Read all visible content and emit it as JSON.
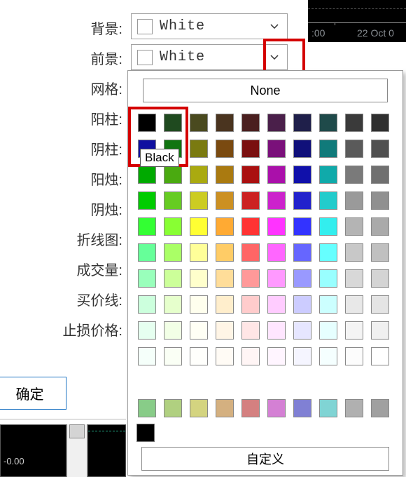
{
  "settings_labels": [
    "背景:",
    "前景:",
    "网格:",
    "阳柱:",
    "阴柱:",
    "阳烛:",
    "阴烛:",
    "折线图:",
    "成交量:",
    "买价线:",
    "止损价格:"
  ],
  "selector1": {
    "color": "#ffffff",
    "label": "White"
  },
  "selector2": {
    "color": "#ffffff",
    "label": "White"
  },
  "ok_button": "确定",
  "none_button": "None",
  "custom_button": "自定义",
  "tooltip": "Black",
  "chart_time_prefix": ":00",
  "chart_date": "22 Oct 0",
  "mini_val": "-0.00",
  "color_grid": [
    [
      "#000000",
      "#1f4a1f",
      "#4a4a1f",
      "#4a341f",
      "#4a1f1f",
      "#4a1f4a",
      "#1f1f4a",
      "#1f4a4a",
      "#3a3a3a",
      "#2f2f2f"
    ],
    [
      "#0f0fa0",
      "#107510",
      "#7a7a10",
      "#7a4a10",
      "#7a1010",
      "#7a107a",
      "#10107a",
      "#107a7a",
      "#5a5a5a",
      "#505050"
    ],
    [
      "#00aa00",
      "#4aaa10",
      "#aaaa10",
      "#aa7a10",
      "#aa1010",
      "#aa10aa",
      "#1010aa",
      "#10aaaa",
      "#7a7a7a",
      "#707070"
    ],
    [
      "#00cc00",
      "#66cc22",
      "#cccc22",
      "#cc9022",
      "#cc2222",
      "#cc22cc",
      "#2222cc",
      "#22cccc",
      "#9a9a9a",
      "#909090"
    ],
    [
      "#33ff33",
      "#88ff33",
      "#ffff33",
      "#ffaa33",
      "#ff3333",
      "#ff33ff",
      "#3333ff",
      "#33eeee",
      "#b4b4b4",
      "#aaaaaa"
    ],
    [
      "#66ff99",
      "#aaff66",
      "#ffff99",
      "#ffcc66",
      "#ff6666",
      "#ff66ff",
      "#6666ff",
      "#66ffff",
      "#c8c8c8",
      "#c0c0c0"
    ],
    [
      "#99ffbb",
      "#ccff99",
      "#ffffcc",
      "#ffdd99",
      "#ff9999",
      "#ff99ff",
      "#9999ff",
      "#99ffff",
      "#d8d8d8",
      "#d4d4d4"
    ],
    [
      "#ccffdd",
      "#e6ffcc",
      "#ffffee",
      "#ffeecc",
      "#ffcccc",
      "#ffccff",
      "#ccccff",
      "#ccffff",
      "#e8e8e8",
      "#e4e4e4"
    ],
    [
      "#e6fff0",
      "#f2ffe6",
      "#fffff5",
      "#fff5e6",
      "#ffe6e6",
      "#ffe6ff",
      "#e6e6ff",
      "#e6ffff",
      "#f4f4f4",
      "#f0f0f0"
    ],
    [
      "#f5fffa",
      "#fafff5",
      "#fffffc",
      "#fffbf5",
      "#fff5f5",
      "#fff5ff",
      "#f5f5ff",
      "#f5ffff",
      "#fcfcfc",
      "#ffffff"
    ],
    [
      "#88cc88",
      "#b0d080",
      "#d4d480",
      "#d4b080",
      "#d48080",
      "#d480d4",
      "#8080d4",
      "#80d4d4",
      "#b0b0b0",
      "#a0a0a0"
    ]
  ]
}
